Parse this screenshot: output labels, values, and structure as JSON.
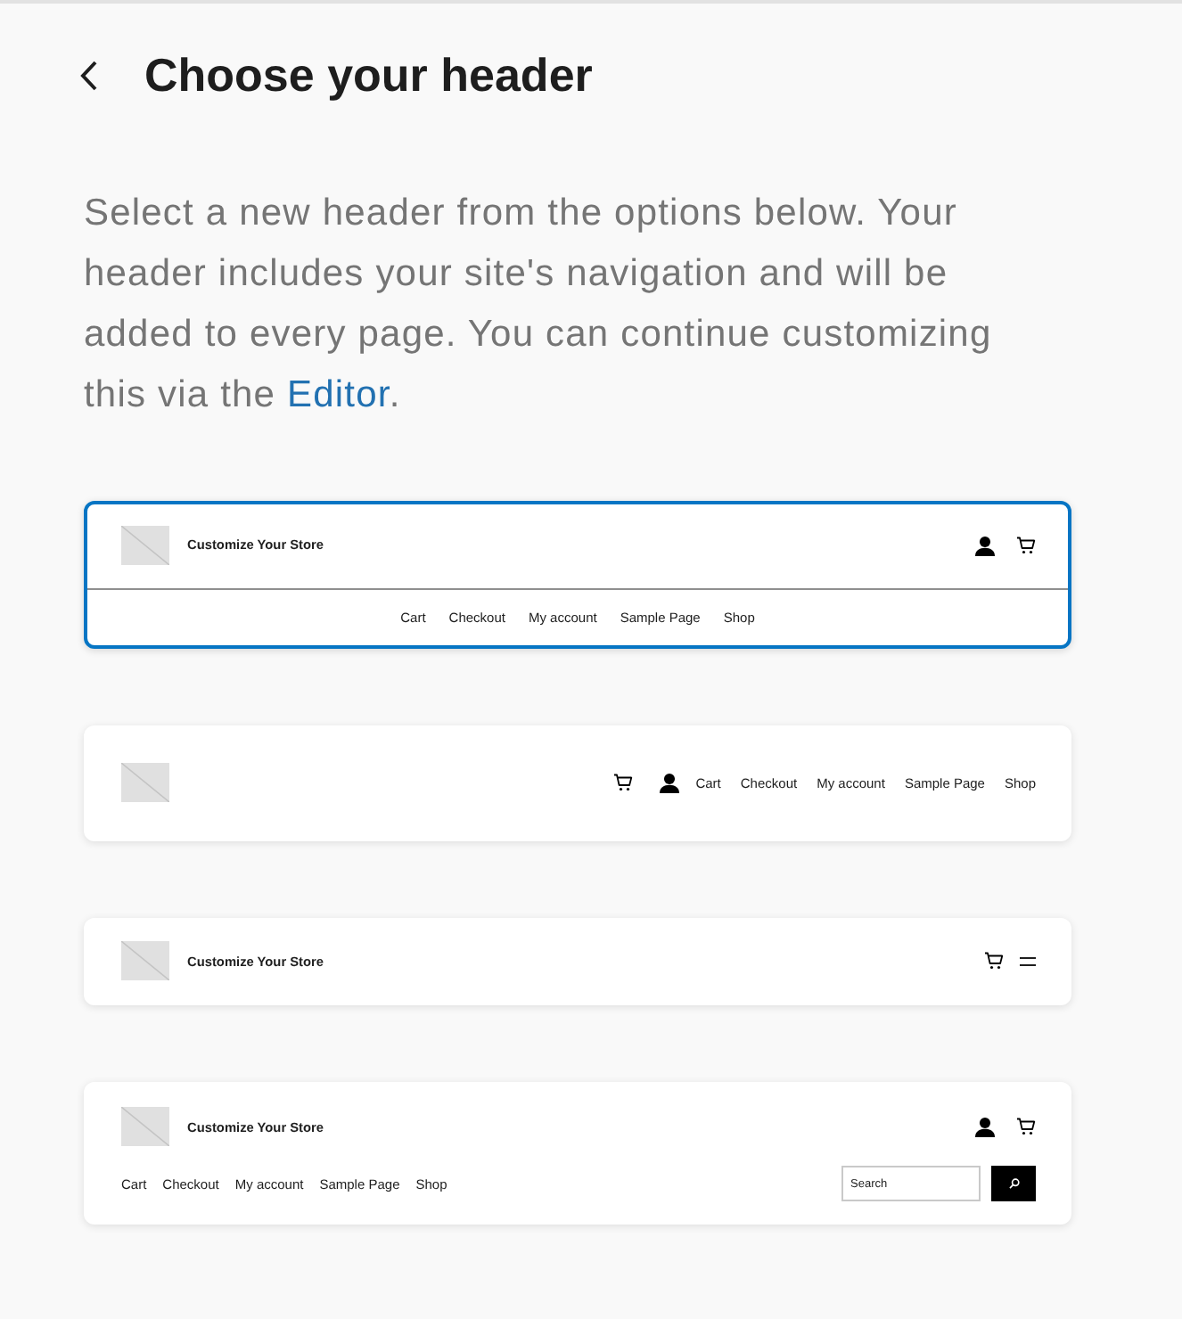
{
  "header": {
    "title": "Choose your header"
  },
  "description": {
    "text": "Select a new header from the options below. Your header includes your site's navigation and will be added to every page. You can continue customizing this via the ",
    "link": "Editor",
    "text_after": "."
  },
  "options": [
    {
      "kind": "centered-nav",
      "selected": true,
      "site_title": "Customize Your Store",
      "nav": [
        "Cart",
        "Checkout",
        "My account",
        "Sample Page",
        "Shop"
      ]
    },
    {
      "kind": "inline-nav",
      "selected": false,
      "nav": [
        "Cart",
        "Checkout",
        "My account",
        "Sample Page",
        "Shop"
      ]
    },
    {
      "kind": "compact",
      "selected": false,
      "site_title": "Customize Your Store"
    },
    {
      "kind": "search",
      "selected": false,
      "site_title": "Customize Your Store",
      "nav": [
        "Cart",
        "Checkout",
        "My account",
        "Sample Page",
        "Shop"
      ],
      "search": {
        "placeholder": "Search"
      }
    }
  ]
}
